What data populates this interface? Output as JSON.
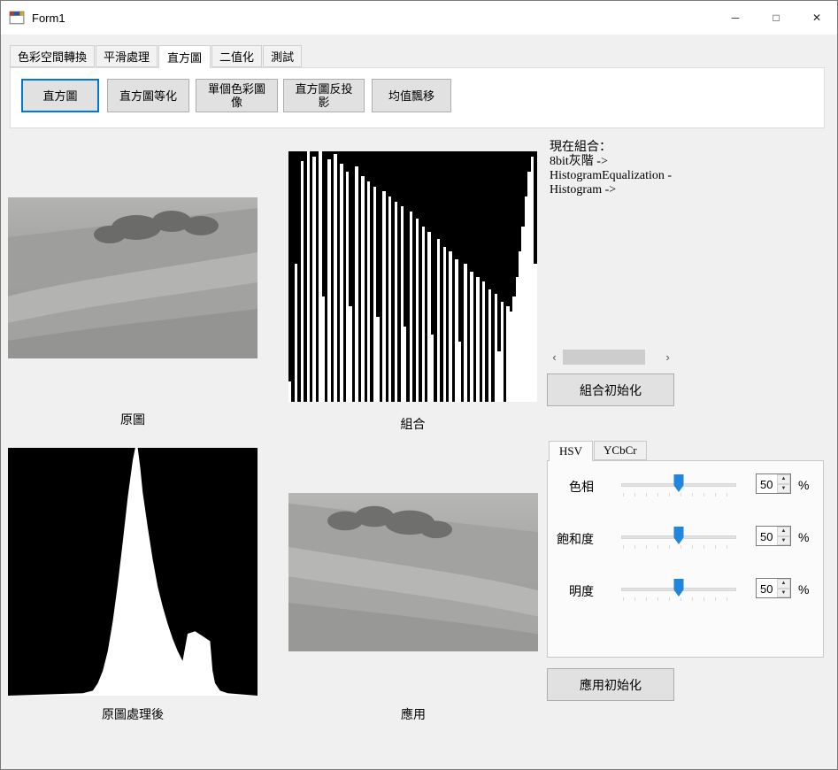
{
  "window": {
    "title": "Form1",
    "minimize_icon": "─",
    "maximize_icon": "□",
    "close_icon": "✕"
  },
  "colors": {
    "accent": "#0078d7",
    "slider_thumb": "#2286dd",
    "button_face": "#e1e1e1"
  },
  "tabs": [
    {
      "label": "色彩空間轉換",
      "active": false
    },
    {
      "label": "平滑處理",
      "active": false
    },
    {
      "label": "直方圖",
      "active": true
    },
    {
      "label": "二值化",
      "active": false
    },
    {
      "label": "測試",
      "active": false
    }
  ],
  "toolbar": {
    "buttons": [
      {
        "label": "直方圖",
        "focused": true
      },
      {
        "label": "直方圖等化",
        "focused": false
      },
      {
        "label": "單個色彩圖\n像",
        "focused": false
      },
      {
        "label": "直方圖反投\n影",
        "focused": false
      },
      {
        "label": "均值飄移",
        "focused": false
      }
    ]
  },
  "status": {
    "lines": [
      "現在組合：",
      "8bit灰階 ->",
      "HistogramEqualization -",
      "Histogram ->"
    ]
  },
  "captions": {
    "original": "原圖",
    "combination": "組合",
    "processed": "原圖處理後",
    "applied": "應用"
  },
  "combo_section": {
    "init_button": "組合初始化",
    "scroll_left_icon": "‹",
    "scroll_right_icon": "›"
  },
  "apply_section": {
    "init_button": "應用初始化"
  },
  "hsv_panel": {
    "tabs": [
      {
        "label": "HSV",
        "active": true
      },
      {
        "label": "YCbCr",
        "active": false
      }
    ],
    "sliders": [
      {
        "label": "色相",
        "value": "50",
        "unit": "%",
        "percent": 50
      },
      {
        "label": "飽和度",
        "value": "50",
        "unit": "%",
        "percent": 50
      },
      {
        "label": "明度",
        "value": "50",
        "unit": "%",
        "percent": 50
      }
    ],
    "spinner_up_icon": "▲",
    "spinner_down_icon": "▼"
  },
  "chart_data": [
    {
      "name": "combination-histogram",
      "type": "bar",
      "title": "組合",
      "background": "#000000",
      "bar_color": "#ffffff",
      "ylim": [
        0,
        100
      ],
      "values": [
        8,
        0,
        55,
        0,
        96,
        0,
        100,
        0,
        98,
        0,
        100,
        42,
        0,
        97,
        0,
        99,
        0,
        95,
        0,
        92,
        38,
        0,
        94,
        0,
        90,
        0,
        88,
        0,
        86,
        34,
        0,
        84,
        0,
        82,
        0,
        80,
        0,
        78,
        30,
        0,
        76,
        0,
        73,
        0,
        70,
        0,
        68,
        27,
        0,
        65,
        0,
        62,
        0,
        60,
        0,
        57,
        24,
        0,
        55,
        0,
        52,
        0,
        50,
        0,
        48,
        0,
        45,
        0,
        43,
        20,
        40,
        0,
        38,
        36,
        42,
        50,
        60,
        70,
        82,
        92,
        98,
        55
      ]
    },
    {
      "name": "processed-histogram",
      "type": "area",
      "title": "原圖處理後",
      "background": "#000000",
      "fill_color": "#ffffff",
      "xlim": [
        0,
        100
      ],
      "ylim": [
        0,
        100
      ],
      "points": [
        [
          0,
          0
        ],
        [
          30,
          1
        ],
        [
          34,
          2
        ],
        [
          36,
          5
        ],
        [
          38,
          10
        ],
        [
          40,
          18
        ],
        [
          42,
          30
        ],
        [
          44,
          45
        ],
        [
          46,
          62
        ],
        [
          48,
          80
        ],
        [
          50,
          95
        ],
        [
          51,
          100
        ],
        [
          52,
          100
        ],
        [
          53,
          92
        ],
        [
          54,
          82
        ],
        [
          56,
          68
        ],
        [
          58,
          55
        ],
        [
          60,
          44
        ],
        [
          62,
          36
        ],
        [
          64,
          29
        ],
        [
          66,
          23
        ],
        [
          68,
          18
        ],
        [
          70,
          14
        ],
        [
          72,
          25
        ],
        [
          75,
          26
        ],
        [
          78,
          24
        ],
        [
          81,
          22
        ],
        [
          82,
          10
        ],
        [
          83,
          5
        ],
        [
          85,
          2
        ],
        [
          88,
          1
        ],
        [
          100,
          0
        ]
      ]
    }
  ]
}
